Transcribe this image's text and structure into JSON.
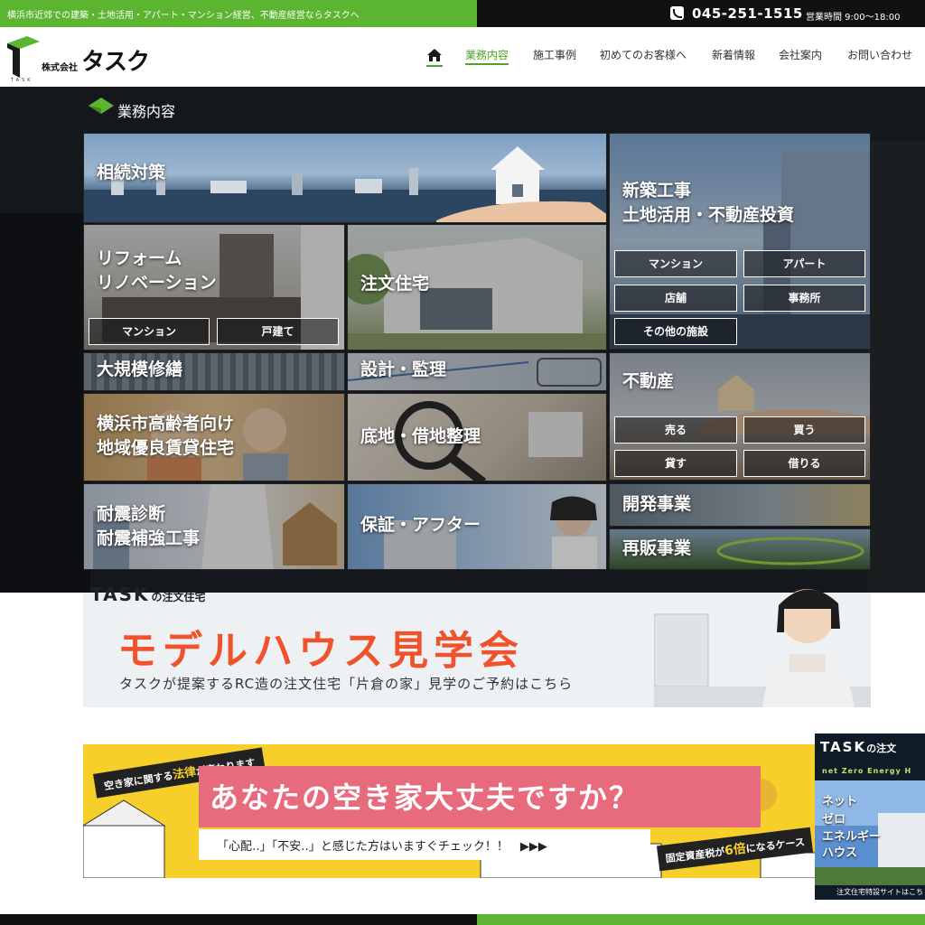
{
  "topbar": {
    "tagline": "横浜市近郊での建築・土地活用・アパート・マンション経営、不動産経営ならタスクへ",
    "phone": "045-251-1515",
    "hours": "営業時間 9:00～18:00"
  },
  "header": {
    "logo_small": "株式会社",
    "logo_big": "タスク",
    "logo_sub": "TASK",
    "nav": [
      {
        "label": "業務内容",
        "active": true
      },
      {
        "label": "施工事例"
      },
      {
        "label": "初めてのお客様へ"
      },
      {
        "label": "新着情報"
      },
      {
        "label": "会社案内"
      },
      {
        "label": "お問い合わせ"
      }
    ]
  },
  "menu": {
    "title": "業務内容",
    "tiles": {
      "souzoku": "相続対策",
      "shinchiku_1": "新築工事",
      "shinchiku_2": "土地活用・不動産投資",
      "reform_1": "リフォーム",
      "reform_2": "リノベーション",
      "chumon": "注文住宅",
      "daikibo": "大規模修繕",
      "sekkei": "設計・監理",
      "fudosan": "不動産",
      "koreisha_1": "横浜市高齢者向け",
      "koreisha_2": "地域優良賃貸住宅",
      "sokochi": "底地・借地整理",
      "taishin_1": "耐震診断",
      "taishin_2": "耐震補強工事",
      "hosho": "保証・アフター",
      "kaihatsu": "開発事業",
      "saihan": "再販事業"
    },
    "chips": {
      "shinchiku": [
        "マンション",
        "アパート",
        "店舗",
        "事務所",
        "その他の施設"
      ],
      "reform": [
        "マンション",
        "戸建て"
      ],
      "fudosan": [
        "売る",
        "買う",
        "貸す",
        "借りる"
      ]
    }
  },
  "banner_model": {
    "brand": "TASK",
    "brand_suffix": "の注文住宅",
    "title": "モデルハウス見学会",
    "desc": "タスクが提案するRC造の注文住宅「片倉の家」見学のご予約はこちら"
  },
  "banner_akiya": {
    "ribbon_pre": "空き家に関する",
    "ribbon_em": "法律",
    "ribbon_post": "が変わります",
    "title": "あなたの空き家大丈夫ですか？",
    "check": "「心配‥」「不安‥」と感じた方はいますぐチェック！！　▶▶▶",
    "tax_pre": "固定資産税が",
    "tax_em": "6倍",
    "tax_post": "になるケース"
  },
  "side_ad": {
    "brand": "TASK",
    "brand_suffix": "の注文",
    "nze": "net Zero Energy H",
    "words": [
      "ネット",
      "ゼロ",
      "エネルギー",
      "ハウス"
    ],
    "footer": "注文住宅特設サイトはこち"
  },
  "colors": {
    "green": "#5cb531",
    "orange": "#f0532b",
    "yellow": "#f6cf2b",
    "pink": "#e86b7d"
  }
}
